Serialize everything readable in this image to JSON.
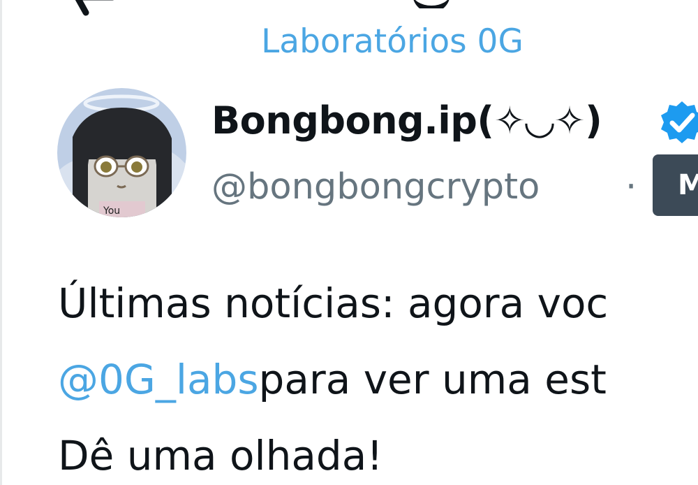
{
  "header": {
    "subtitle": "Laboratórios 0G"
  },
  "author": {
    "display_name": "Bongbong.ip(✧◡✧)",
    "handle": "@bongbongcrypto",
    "separator": "·",
    "badge_letter": "M",
    "verified": true
  },
  "tweet": {
    "line1": "Últimas notícias: agora voc",
    "mention": "@0G_labs",
    "line2_rest": "para ver uma est",
    "line3": "Dê uma olhada!"
  },
  "colors": {
    "link": "#4ba6e3",
    "text": "#0f1419",
    "muted": "#66757f",
    "verified": "#1d9bf0"
  },
  "icons": {
    "back": "arrow-left-icon",
    "verified": "verified-badge-icon"
  }
}
